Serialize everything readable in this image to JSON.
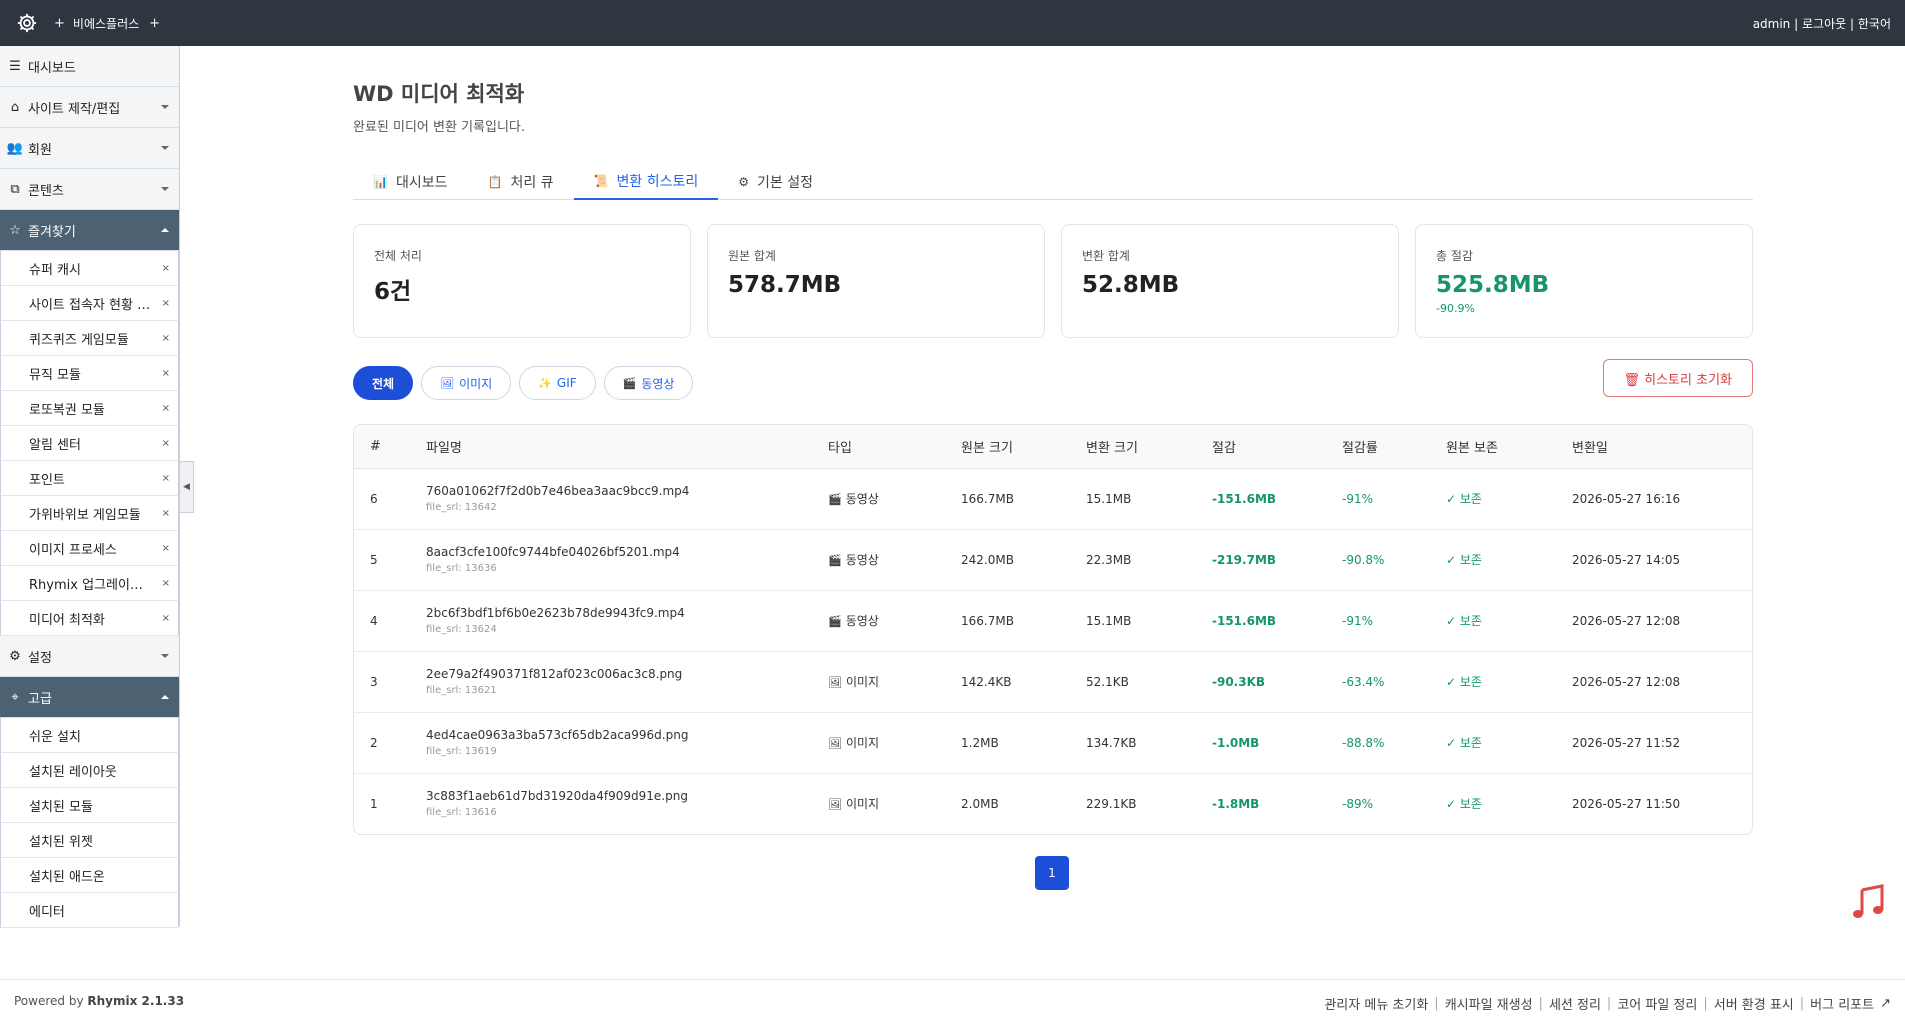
{
  "topbar": {
    "site_name": "비에스플러스",
    "plus": "+",
    "user": "admin",
    "logout": "로그아웃",
    "language": "한국어",
    "sep": "|"
  },
  "sidebar": {
    "dashboard": "대시보드",
    "site_edit": "사이트 제작/편집",
    "members": "회원",
    "contents": "콘텐츠",
    "favorites": "즐겨찾기",
    "favorite_items": [
      "슈퍼 캐시",
      "사이트 접속자 현황 모듈",
      "퀴즈퀴즈 게임모듈",
      "뮤직 모듈",
      "로또복권 모듈",
      "알림 센터",
      "포인트",
      "가위바위보 게임모듈",
      "이미지 프로세스",
      "Rhymix 업그레이드 모듈",
      "미디어 최적화"
    ],
    "settings": "설정",
    "advanced": "고급",
    "advanced_items": [
      "쉬운 설치",
      "설치된 레이아웃",
      "설치된 모듈",
      "설치된 위젯",
      "설치된 애드온",
      "에디터"
    ],
    "remove_mark": "×"
  },
  "page": {
    "title": "WD 미디어 최적화",
    "description": "완료된 미디어 변환 기록입니다."
  },
  "tabs": [
    {
      "icon": "📊",
      "label": "대시보드"
    },
    {
      "icon": "📋",
      "label": "처리 큐"
    },
    {
      "icon": "📜",
      "label": "변환 히스토리"
    },
    {
      "icon": "⚙",
      "label": "기본 설정"
    }
  ],
  "stats": [
    {
      "label": "전체 처리",
      "value": "6건"
    },
    {
      "label": "원본 합계",
      "value": "578.7MB"
    },
    {
      "label": "변환 합계",
      "value": "52.8MB"
    },
    {
      "label": "총 절감",
      "value": "525.8MB",
      "sub": "-90.9%"
    }
  ],
  "filters": [
    {
      "icon": "",
      "label": "전체"
    },
    {
      "icon": "🖼",
      "label": "이미지"
    },
    {
      "icon": "✨",
      "label": "GIF"
    },
    {
      "icon": "🎬",
      "label": "동영상"
    }
  ],
  "reset_button": "🗑 히스토리 초기화",
  "table": {
    "headers": [
      "#",
      "파일명",
      "타입",
      "원본 크기",
      "변환 크기",
      "절감",
      "절감률",
      "원본 보존",
      "변환일"
    ],
    "rows": [
      {
        "no": "6",
        "file": "760a01062f7f2d0b7e46bea3aac9bcc9.mp4",
        "srl": "file_srl: 13642",
        "type_icon": "🎬",
        "type": "동영상",
        "orig": "166.7MB",
        "conv": "15.1MB",
        "saved": "-151.6MB",
        "rate": "-91%",
        "keep": "✓ 보존",
        "date": "2026-05-27 16:16"
      },
      {
        "no": "5",
        "file": "8aacf3cfe100fc9744bfe04026bf5201.mp4",
        "srl": "file_srl: 13636",
        "type_icon": "🎬",
        "type": "동영상",
        "orig": "242.0MB",
        "conv": "22.3MB",
        "saved": "-219.7MB",
        "rate": "-90.8%",
        "keep": "✓ 보존",
        "date": "2026-05-27 14:05"
      },
      {
        "no": "4",
        "file": "2bc6f3bdf1bf6b0e2623b78de9943fc9.mp4",
        "srl": "file_srl: 13624",
        "type_icon": "🎬",
        "type": "동영상",
        "orig": "166.7MB",
        "conv": "15.1MB",
        "saved": "-151.6MB",
        "rate": "-91%",
        "keep": "✓ 보존",
        "date": "2026-05-27 12:08"
      },
      {
        "no": "3",
        "file": "2ee79a2f490371f812af023c006ac3c8.png",
        "srl": "file_srl: 13621",
        "type_icon": "🖼",
        "type": "이미지",
        "orig": "142.4KB",
        "conv": "52.1KB",
        "saved": "-90.3KB",
        "rate": "-63.4%",
        "keep": "✓ 보존",
        "date": "2026-05-27 12:08"
      },
      {
        "no": "2",
        "file": "4ed4cae0963a3ba573cf65db2aca996d.png",
        "srl": "file_srl: 13619",
        "type_icon": "🖼",
        "type": "이미지",
        "orig": "1.2MB",
        "conv": "134.7KB",
        "saved": "-1.0MB",
        "rate": "-88.8%",
        "keep": "✓ 보존",
        "date": "2026-05-27 11:52"
      },
      {
        "no": "1",
        "file": "3c883f1aeb61d7bd31920da4f909d91e.png",
        "srl": "file_srl: 13616",
        "type_icon": "🖼",
        "type": "이미지",
        "orig": "2.0MB",
        "conv": "229.1KB",
        "saved": "-1.8MB",
        "rate": "-89%",
        "keep": "✓ 보존",
        "date": "2026-05-27 11:50"
      }
    ]
  },
  "pagination": {
    "current": "1"
  },
  "footer": {
    "powered_prefix": "Powered by",
    "powered_name": "Rhymix 2.1.33",
    "links": [
      "관리자 메뉴 초기화",
      "캐시파일 재생성",
      "세션 정리",
      "코어 파일 정리",
      "서버 환경 표시",
      "버그 리포트"
    ],
    "sep": "|",
    "external": "↗"
  },
  "colors": {
    "accent": "#1d4ed8",
    "topbar": "#2e363f",
    "success": "#16956b",
    "danger": "#d63b3b"
  }
}
